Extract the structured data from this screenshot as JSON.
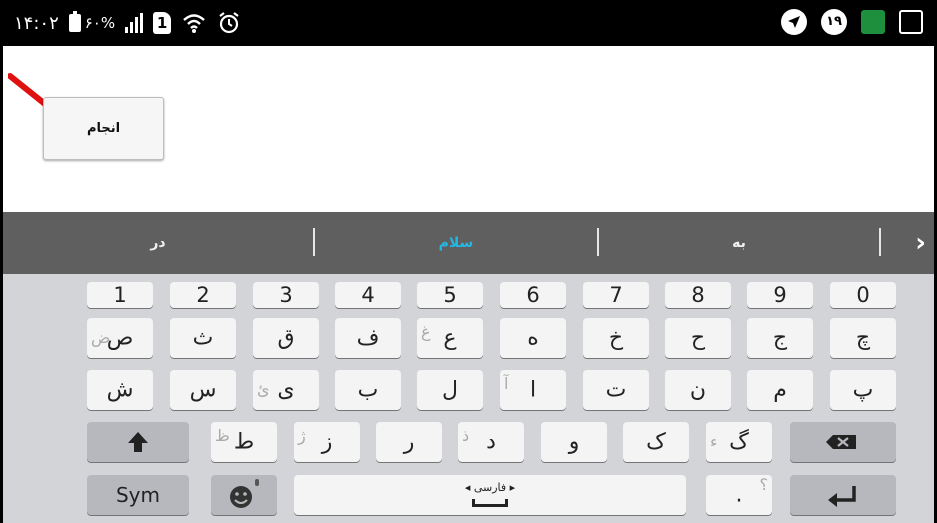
{
  "statusbar": {
    "time": "۱۴:۰۲",
    "battery_percent": "۶۰%",
    "sim_label": "1",
    "notif_badge": "۱۹",
    "icons": [
      "battery-icon",
      "signal-icon",
      "sim-icon",
      "wifi-icon",
      "alarm-icon",
      "location-icon",
      "notification-badge-icon",
      "app-icon",
      "screenshot-icon"
    ]
  },
  "done_button": {
    "label": "انجام"
  },
  "suggestions": {
    "items": [
      "در",
      "سلام",
      "به"
    ],
    "highlight_color": "#22b8e6",
    "more_icon": "chevron-right-icon"
  },
  "keyboard": {
    "numbers": [
      "1",
      "2",
      "3",
      "4",
      "5",
      "6",
      "7",
      "8",
      "9",
      "0"
    ],
    "row1": [
      {
        "main": "ص",
        "alt": "ض"
      },
      {
        "main": "ث",
        "alt": ""
      },
      {
        "main": "ق",
        "alt": ""
      },
      {
        "main": "ف",
        "alt": ""
      },
      {
        "main": "ع",
        "alt": "غ"
      },
      {
        "main": "ه",
        "alt": ""
      },
      {
        "main": "خ",
        "alt": ""
      },
      {
        "main": "ح",
        "alt": ""
      },
      {
        "main": "ج",
        "alt": ""
      },
      {
        "main": "چ",
        "alt": ""
      }
    ],
    "row2": [
      {
        "main": "ش",
        "alt": ""
      },
      {
        "main": "س",
        "alt": ""
      },
      {
        "main": "ی",
        "alt": "ئ"
      },
      {
        "main": "ب",
        "alt": ""
      },
      {
        "main": "ل",
        "alt": ""
      },
      {
        "main": "ا",
        "alt": "آ"
      },
      {
        "main": "ت",
        "alt": ""
      },
      {
        "main": "ن",
        "alt": ""
      },
      {
        "main": "م",
        "alt": ""
      },
      {
        "main": "پ",
        "alt": ""
      }
    ],
    "row3": [
      {
        "main": "ط",
        "alt": "ظ"
      },
      {
        "main": "ز",
        "alt": "ژ"
      },
      {
        "main": "ر",
        "alt": ""
      },
      {
        "main": "د",
        "alt": "ذ"
      },
      {
        "main": "و",
        "alt": ""
      },
      {
        "main": "ک",
        "alt": ""
      },
      {
        "main": "گ",
        "alt": "ء"
      }
    ],
    "shift_icon": "shift-arrow-icon",
    "backspace_icon": "backspace-icon",
    "sym_label": "Sym",
    "emoji_icon": "emoji-mic-icon",
    "space_label": "فارسی",
    "period_label": ".",
    "period_alt": "؟",
    "enter_icon": "enter-icon"
  }
}
